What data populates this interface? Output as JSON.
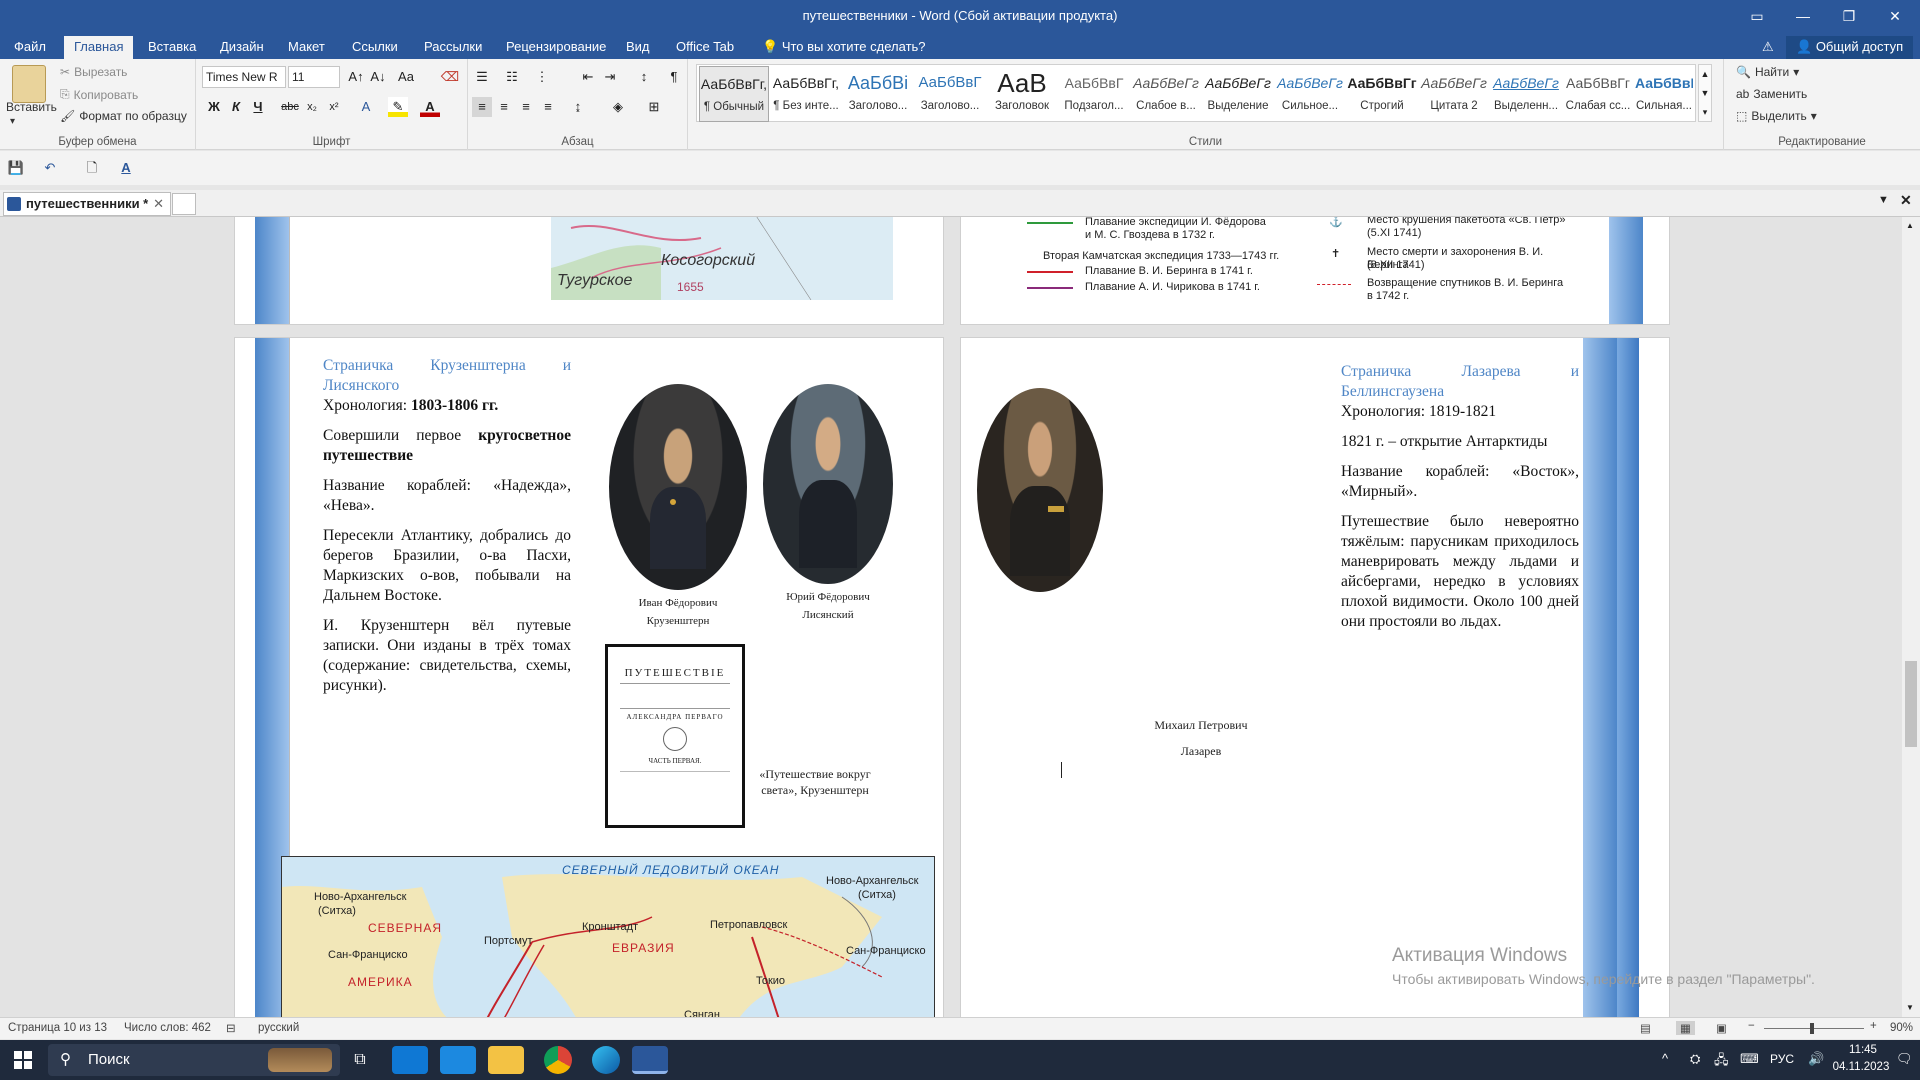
{
  "window": {
    "title": "путешественники - Word (Сбой активации продукта)"
  },
  "tabs": [
    "Файл",
    "Главная",
    "Вставка",
    "Дизайн",
    "Макет",
    "Ссылки",
    "Рассылки",
    "Рецензирование",
    "Вид",
    "Office Tab"
  ],
  "tell_me": "Что вы хотите сделать?",
  "share": "Общий доступ",
  "clipboard": {
    "paste": "Вставить",
    "cut": "Вырезать",
    "copy": "Копировать",
    "format_painter": "Формат по образцу",
    "label": "Буфер обмена"
  },
  "font": {
    "name": "Times New R",
    "size": "11",
    "label": "Шрифт",
    "bold": "Ж",
    "italic": "К",
    "underline": "Ч",
    "strike": "abc"
  },
  "paragraph": {
    "label": "Абзац"
  },
  "styles": {
    "label": "Стили",
    "items": [
      {
        "preview": "АаБбВвГг,",
        "name": "¶ Обычный"
      },
      {
        "preview": "АаБбВвГг,",
        "name": "¶ Без инте..."
      },
      {
        "preview": "АаБбВі",
        "name": "Заголово..."
      },
      {
        "preview": "АаБбВвГ",
        "name": "Заголово..."
      },
      {
        "preview": "АаВ",
        "name": "Заголовок"
      },
      {
        "preview": "АаБбВвГ",
        "name": "Подзагол..."
      },
      {
        "preview": "АаБбВеГг",
        "name": "Слабое в..."
      },
      {
        "preview": "АаБбВеГг",
        "name": "Выделение"
      },
      {
        "preview": "АаБбВеГг",
        "name": "Сильное..."
      },
      {
        "preview": "АаБбВвГг",
        "name": "Строгий"
      },
      {
        "preview": "АаБбВеГг",
        "name": "Цитата 2"
      },
      {
        "preview": "АаБбВеГг",
        "name": "Выделенн..."
      },
      {
        "preview": "АаБбВвГг",
        "name": "Слабая сс..."
      },
      {
        "preview": "АаБбВвГг",
        "name": "Сильная..."
      }
    ]
  },
  "editing": {
    "find": "Найти",
    "replace": "Заменить",
    "select": "Выделить",
    "label": "Редактирование"
  },
  "doc_tab": "путешественники *",
  "page_top_right": {
    "legend": [
      "Плавание экспедиции И. Фёдорова",
      "и М. С. Гвоздева в 1732 г.",
      "Вторая Камчатская экспедиция 1733—1743 гг.",
      "Плавание В. И. Беринга в 1741 г.",
      "Плавание А. И. Чирикова в 1741 г.",
      "Место крушения пакетбота «Св. Петр»",
      "(5.XI 1741)",
      "Место смерти и захоронения В. И. Беринга",
      "(8.XII 1741)",
      "Возвращение спутников В. И. Беринга",
      "в 1742 г."
    ]
  },
  "page_top_left": {
    "map_labels": [
      "Косогорский",
      "Тугурское",
      "1655"
    ]
  },
  "left_page": {
    "heading": "Страничка Крузенштерна и Лисянского",
    "chron_label": "Хронология: ",
    "chron_value": "1803-1806 гг.",
    "p1_a": "Совершили первое ",
    "p1_b": "кругосветное путешествие",
    "p2": "Название кораблей: «Надежда», «Нева».",
    "p3": "Пересекли Атлантику, добрались до берегов Бразилии, о-ва Пасхи, Маркизских о-вов, побывали на Дальнем Востоке.",
    "p4": "И. Крузенштерн вёл путевые записки. Они изданы в трёх томах (содержание: свидетельства, схемы, рисунки).",
    "cap1_a": "Иван Фёдорович",
    "cap1_b": "Крузенштерн",
    "cap2_a": "Юрий Фёдорович",
    "cap2_b": "Лисянский",
    "book_caption_a": "«Путешествие вокруг",
    "book_caption_b": "света», Крузенштерн",
    "book": {
      "title": "ПУТЕШЕСТВІЕ",
      "sub": "АЛЕКСАНДРА ПЕРВАГО",
      "part": "ЧАСТЬ ПЕРВАЯ."
    },
    "map_labels": [
      "СЕВЕРНЫЙ ЛЕДОВИТЫЙ ОКЕАН",
      "Ново-Архангельск",
      "(Ситха)",
      "Ново-Архангельск",
      "(Ситха)",
      "СЕВЕРНАЯ",
      "Портсмут",
      "Кронштадт",
      "Петропавловск",
      "Сан-Франциско",
      "ЕВРАЗИЯ",
      "Сан-Франциско",
      "АМЕРИКА",
      "Токио",
      "Сянган"
    ]
  },
  "right_page": {
    "heading": "Страничка Лазарева и Беллинсгаузена",
    "chron": "Хронология: 1819-1821",
    "p1": "1821 г. – открытие Антарктиды",
    "p2": "Название кораблей: «Восток», «Мирный».",
    "p3": "Путешествие было невероятно тяжёлым: парусникам приходилось маневрировать между льдами и айсбергами, нередко в условиях плохой видимости. Около 100 дней они простояли во льдах.",
    "cap_a": "Михаил Петрович",
    "cap_b": "Лазарев"
  },
  "activation": {
    "title": "Активация Windows",
    "text": "Чтобы активировать Windows, перейдите в раздел \"Параметры\"."
  },
  "status": {
    "page": "Страница 10 из 13",
    "words": "Число слов: 462",
    "lang": "русский",
    "zoom": "90%"
  },
  "taskbar": {
    "search": "Поиск",
    "lang": "РУС",
    "time": "11:45",
    "date": "04.11.2023"
  }
}
